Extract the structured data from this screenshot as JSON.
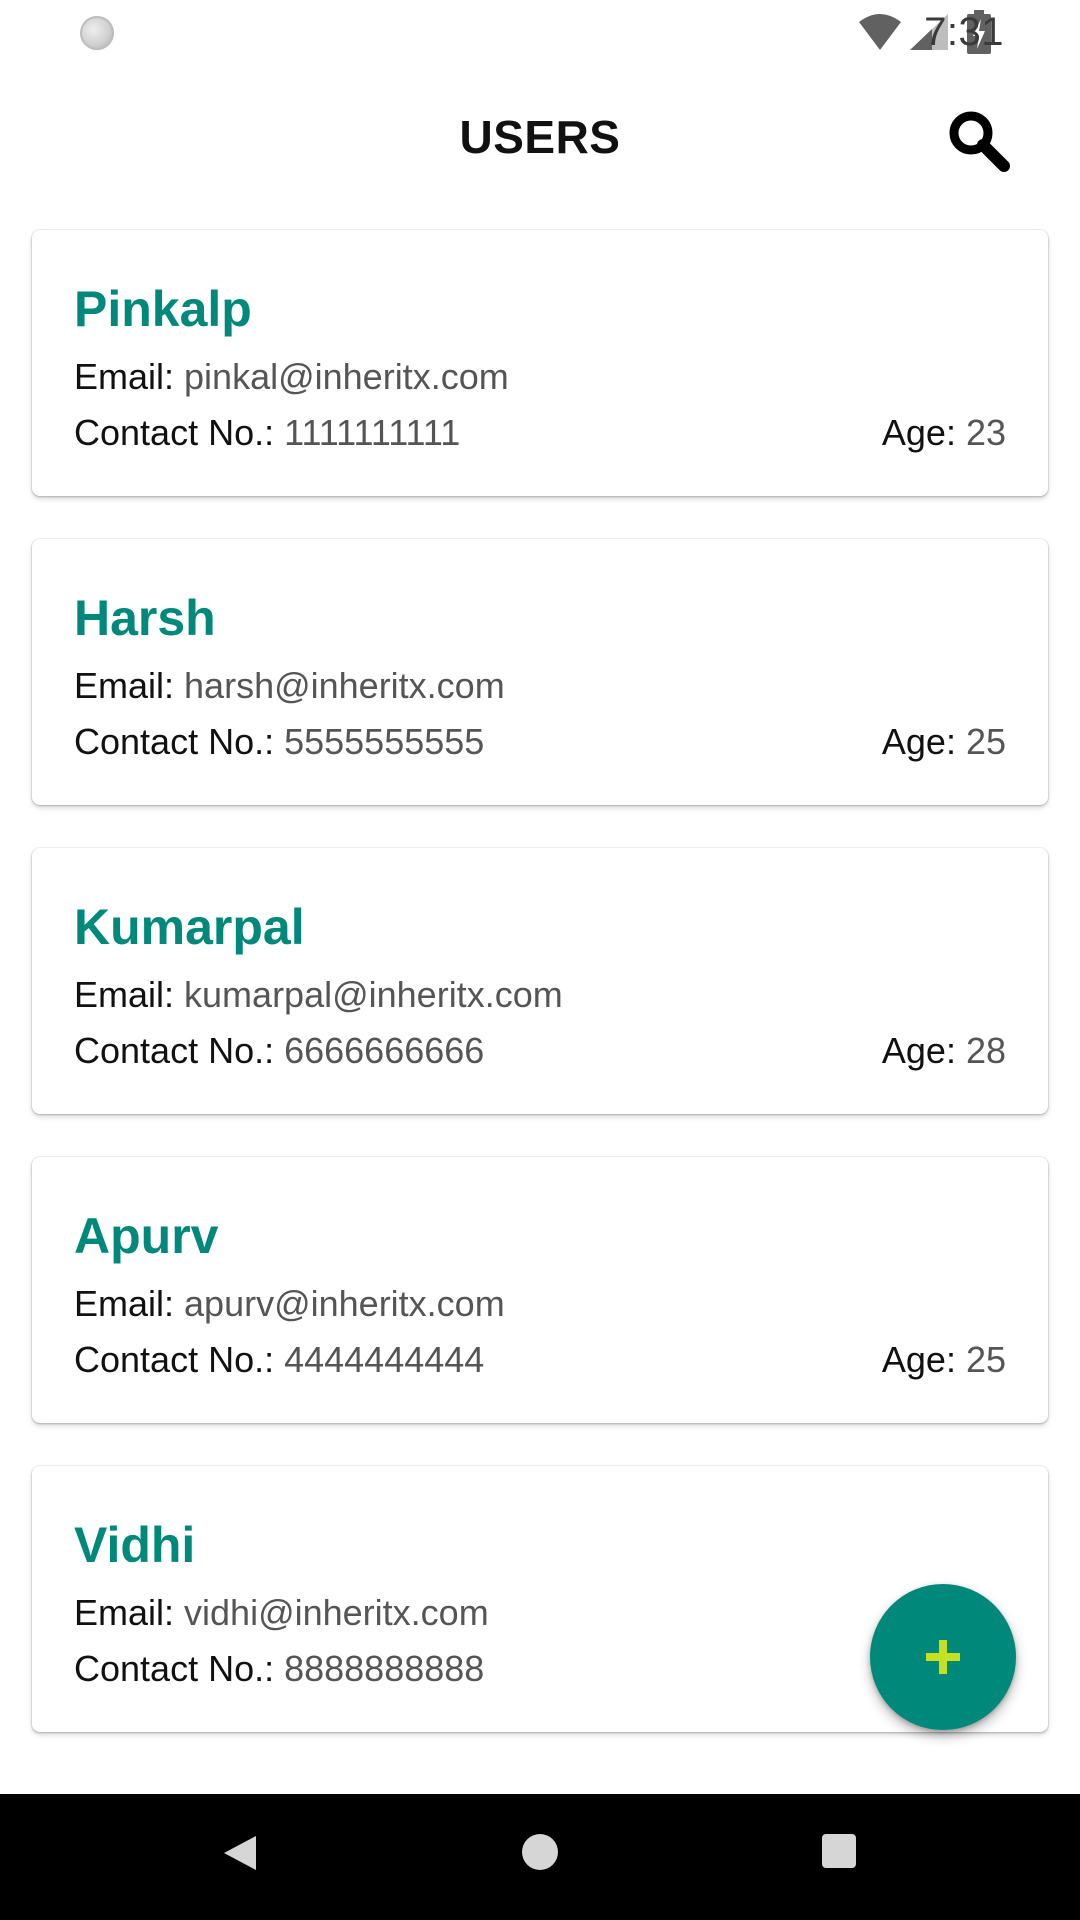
{
  "status_bar": {
    "time": "7:31"
  },
  "app_bar": {
    "title": "USERS",
    "search_icon": "search-icon"
  },
  "labels": {
    "email": "Email: ",
    "contact": "Contact No.: ",
    "age": "Age: "
  },
  "users": [
    {
      "name": "Pinkalp",
      "email": "pinkal@inheritx.com",
      "contact": "1111111111",
      "age": "23"
    },
    {
      "name": "Harsh",
      "email": "harsh@inheritx.com",
      "contact": "5555555555",
      "age": "25"
    },
    {
      "name": "Kumarpal",
      "email": "kumarpal@inheritx.com",
      "contact": "6666666666",
      "age": "28"
    },
    {
      "name": "Apurv",
      "email": "apurv@inheritx.com",
      "contact": "4444444444",
      "age": "25"
    },
    {
      "name": "Vidhi",
      "email": "vidhi@inheritx.com",
      "contact": "8888888888",
      "age": ""
    }
  ],
  "fab": {
    "icon": "plus-icon"
  },
  "colors": {
    "accent": "#00897b",
    "fab_plus": "#c6e021",
    "nav_bar": "#000000"
  }
}
